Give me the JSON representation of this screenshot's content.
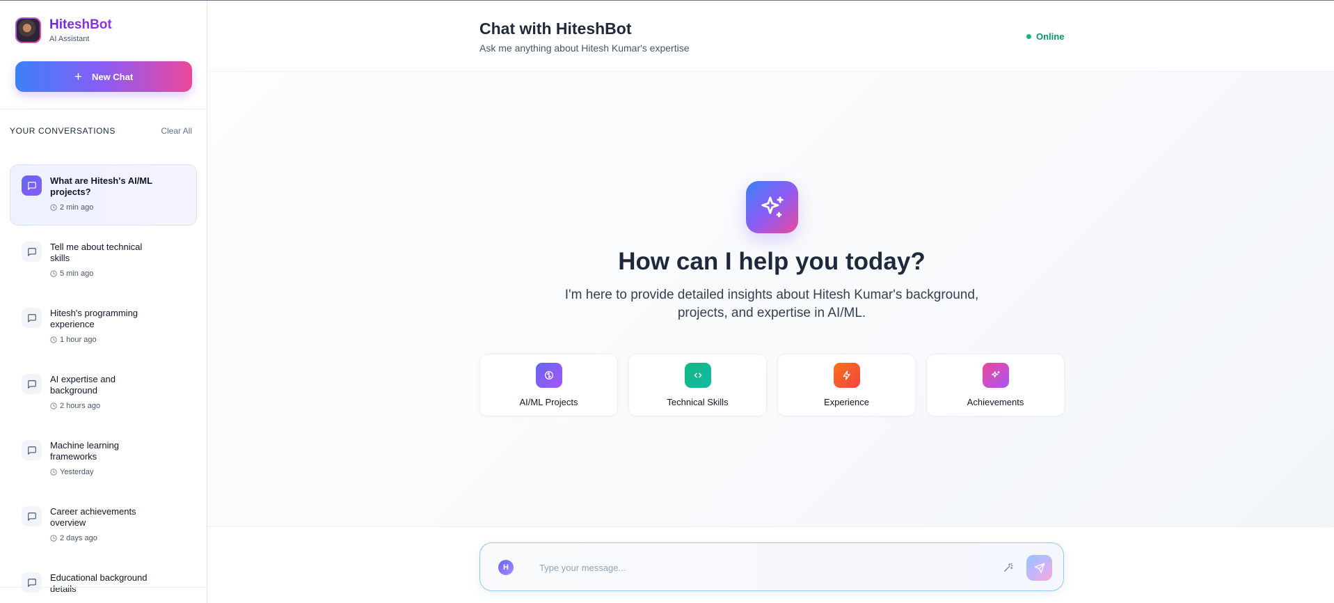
{
  "sidebar": {
    "brand_name": "HiteshBot",
    "brand_sub": "AI Assistant",
    "new_chat_label": "New Chat",
    "section_title": "YOUR CONVERSATIONS",
    "clear_all_label": "Clear All",
    "conversations": [
      {
        "label": "What are Hitesh's AI/ML projects?",
        "time": "2 min ago",
        "active": true
      },
      {
        "label": "Tell me about technical skills",
        "time": "5 min ago"
      },
      {
        "label": "Hitesh's programming experience",
        "time": "1 hour ago"
      },
      {
        "label": "AI expertise and background",
        "time": "2 hours ago"
      },
      {
        "label": "Machine learning frameworks",
        "time": "Yesterday"
      },
      {
        "label": "Career achievements overview",
        "time": "2 days ago"
      },
      {
        "label": "Educational background details",
        "time": ""
      }
    ]
  },
  "header": {
    "title": "Chat with HiteshBot",
    "subtitle": "Ask me anything about Hitesh Kumar's expertise",
    "status": "Online"
  },
  "hero": {
    "title": "How can I help you today?",
    "subtitle": "I'm here to provide detailed insights about Hitesh Kumar's background, projects, and expertise in AI/ML."
  },
  "cards": [
    {
      "label": "AI/ML Projects",
      "icon": "brain-icon",
      "color": "#8b5cf6"
    },
    {
      "label": "Technical Skills",
      "icon": "code-icon",
      "color": "#10b981"
    },
    {
      "label": "Experience",
      "icon": "zap-icon",
      "color": "#f97316"
    },
    {
      "label": "Achievements",
      "icon": "sparkles-icon",
      "color": "#db2777"
    }
  ],
  "composer": {
    "avatar_letter": "H",
    "placeholder": "Type your message...",
    "value": ""
  },
  "colors": {
    "accent": "#8b5cf6",
    "online": "#10b981",
    "gradient_start": "#3b82f6",
    "gradient_end": "#ec4899"
  }
}
